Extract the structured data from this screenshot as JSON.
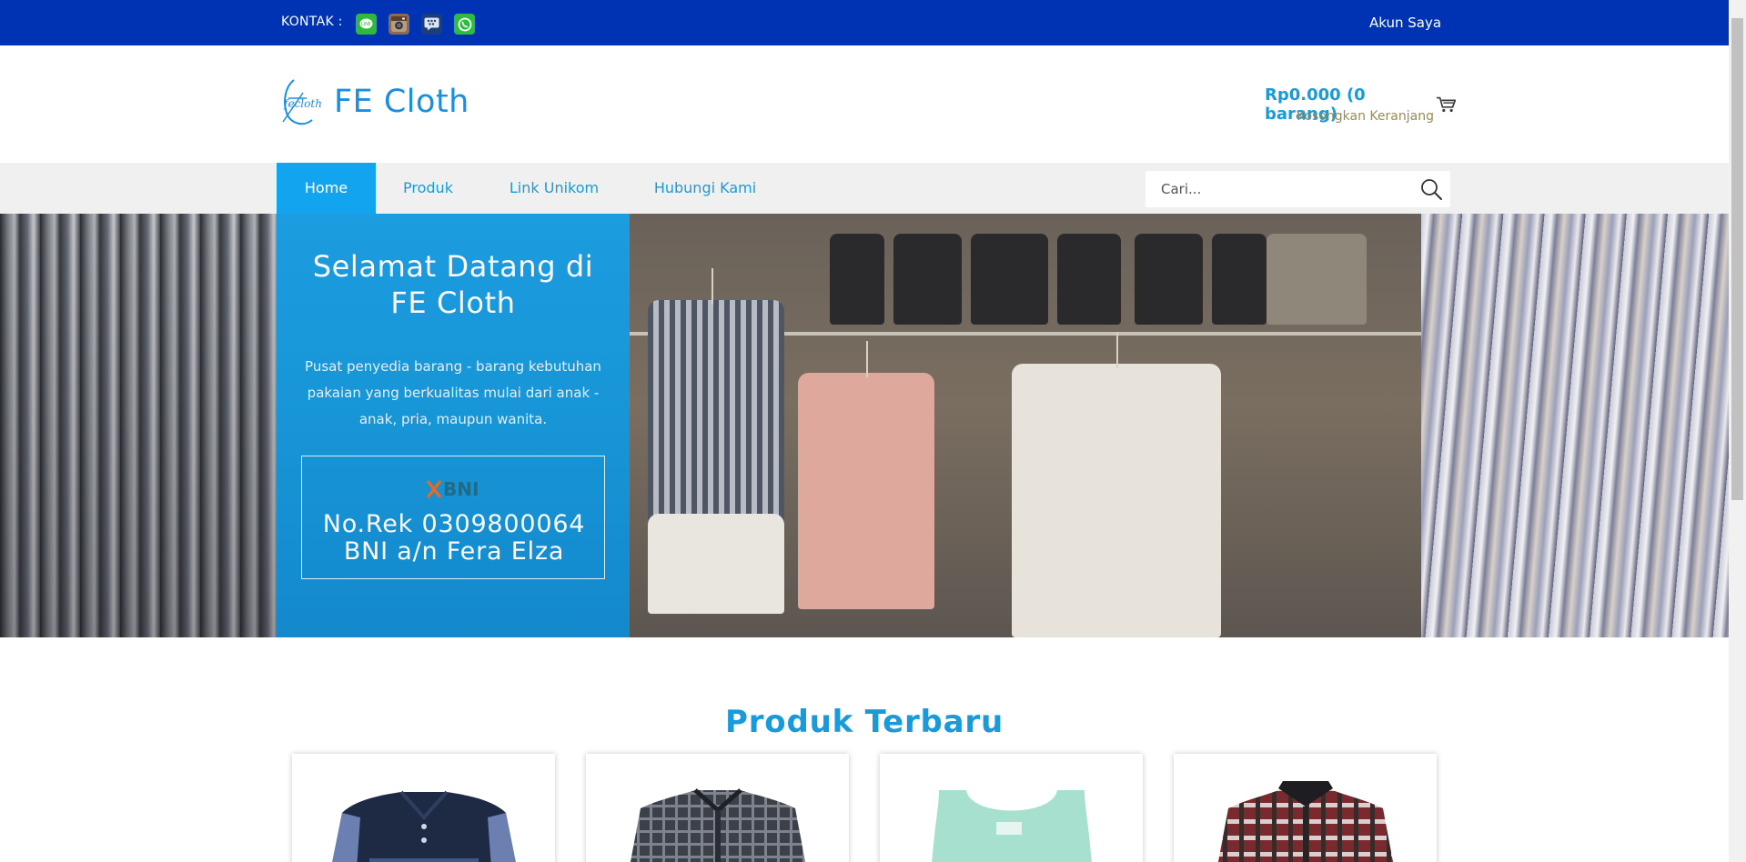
{
  "topbar": {
    "contact_label": "KONTAK :",
    "contact_icons": [
      "line-icon",
      "instagram-icon",
      "blackberry-messenger-icon",
      "whatsapp-icon"
    ],
    "account_label": "Akun Saya"
  },
  "header": {
    "logo_text": "FE Cloth",
    "logo_mark_text": "fecloth",
    "cart_total": "Rp0.000 (0 barang)",
    "cart_empty": "Kosongkan Keranjang"
  },
  "nav": {
    "items": [
      {
        "label": "Home",
        "active": true
      },
      {
        "label": "Produk",
        "active": false
      },
      {
        "label": "Link Unikom",
        "active": false
      },
      {
        "label": "Hubungi Kami",
        "active": false
      }
    ],
    "search_placeholder": "Cari..."
  },
  "hero": {
    "title_line1": "Selamat Datang di",
    "title_line2": "FE Cloth",
    "subtitle": "Pusat penyedia barang - barang kebutuhan pakaian yang berkualitas mulai dari anak - anak, pria, maupun wanita.",
    "bank_name": "BNI",
    "bank_line1": "No.Rek 0309800064",
    "bank_line2": "BNI a/n Fera Elza"
  },
  "products": {
    "section_title": "Produk Terbaru"
  },
  "colors": {
    "topbar": "#0033b3",
    "accent": "#13a4ef",
    "link": "#1a9ad9"
  }
}
